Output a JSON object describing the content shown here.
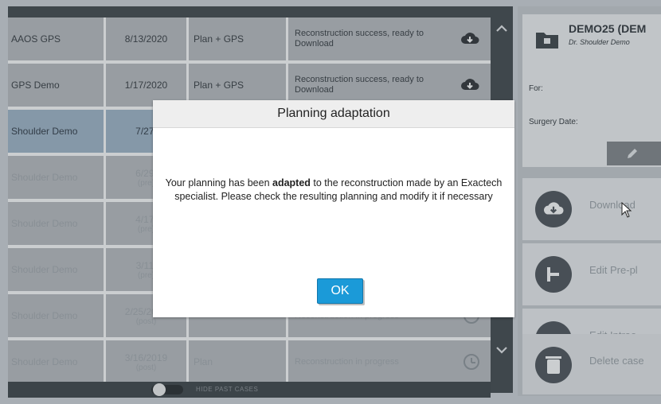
{
  "table": {
    "rows": [
      {
        "name": "AAOS GPS",
        "date": "8/13/2020",
        "type": "Plan + GPS",
        "status": "Reconstruction success, ready to Download",
        "icon": "cloud-download-icon"
      },
      {
        "name": "GPS Demo",
        "date": "1/17/2020",
        "type": "Plan + GPS",
        "status": "Reconstruction success, ready to Download",
        "icon": "cloud-download-icon"
      },
      {
        "name": "Shoulder Demo",
        "date": "7/27/",
        "type": "",
        "status": "",
        "icon": ""
      },
      {
        "name": "Shoulder Demo",
        "date": "6/29/",
        "date_sub": "(pre)",
        "type": "",
        "status": "",
        "icon": ""
      },
      {
        "name": "Shoulder Demo",
        "date": "4/17/",
        "date_sub": "(pre)",
        "type": "",
        "status": "",
        "icon": ""
      },
      {
        "name": "Shoulder Demo",
        "date": "3/11/",
        "date_sub": "(pre)",
        "type": "",
        "status": "",
        "icon": ""
      },
      {
        "name": "Shoulder Demo",
        "date": "2/25/2019",
        "date_sub": "(post)",
        "type": "",
        "status": "Reconstruction in progress",
        "icon": "clock-icon"
      },
      {
        "name": "Shoulder Demo",
        "date": "3/16/2019",
        "date_sub": "(post)",
        "type": "Plan",
        "status": "Reconstruction in progress",
        "icon": "clock-icon"
      }
    ],
    "footer_toggle_label": "HIDE PAST CASES"
  },
  "case_panel": {
    "title": "DEMO25 (DEM",
    "subtitle": "Dr. Shoulder Demo",
    "for_label": "For:",
    "surgery_date_label": "Surgery Date:"
  },
  "actions": [
    {
      "label": "Download",
      "sublabel": "",
      "icon": "cloud-download-icon"
    },
    {
      "label": "Edit Pre-pl",
      "sublabel": "",
      "icon": "arrow-icon"
    },
    {
      "label": "Edit Intrao",
      "sublabel": "",
      "icon": "instrument-icon"
    },
    {
      "label": "Delete case",
      "sublabel": "",
      "icon": "trash-icon"
    }
  ],
  "dialog": {
    "title": "Planning adaptation",
    "message_before": "Your planning has been ",
    "message_bold": "adapted",
    "message_after": " to the reconstruction made by an Exactech specialist. Please check the resulting planning and modify it if necessary",
    "ok_label": "OK"
  },
  "colors": {
    "accent": "#1b9ad8",
    "selected_row": "#9fb4c8",
    "dark_bar": "#3e4449"
  }
}
